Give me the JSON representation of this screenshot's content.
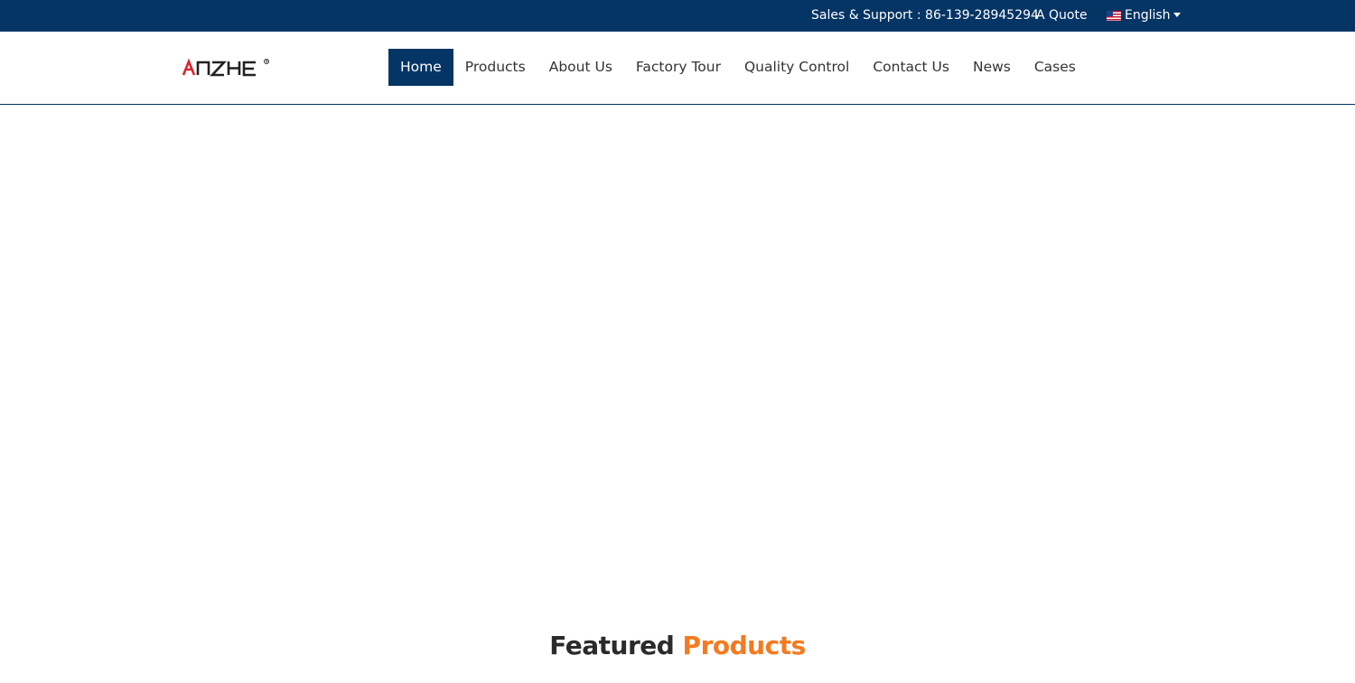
{
  "topbar": {
    "support_text": "Sales & Support : 86-139-28945294",
    "quote_label": "A Quote",
    "language_label": "English",
    "flag_icon": "us-flag-icon",
    "caret_icon": "caret-down-icon"
  },
  "header": {
    "logo_text": "ANZHE",
    "nav": [
      {
        "label": "Home",
        "active": true
      },
      {
        "label": "Products",
        "active": false
      },
      {
        "label": "About Us",
        "active": false
      },
      {
        "label": "Factory Tour",
        "active": false
      },
      {
        "label": "Quality Control",
        "active": false
      },
      {
        "label": "Contact Us",
        "active": false
      },
      {
        "label": "News",
        "active": false
      },
      {
        "label": "Cases",
        "active": false
      }
    ]
  },
  "featured": {
    "title_part1": "Featured",
    "title_part2": "Products"
  },
  "colors": {
    "brand_navy": "#053565",
    "accent_orange": "#f47a20",
    "logo_red": "#d7262f"
  }
}
